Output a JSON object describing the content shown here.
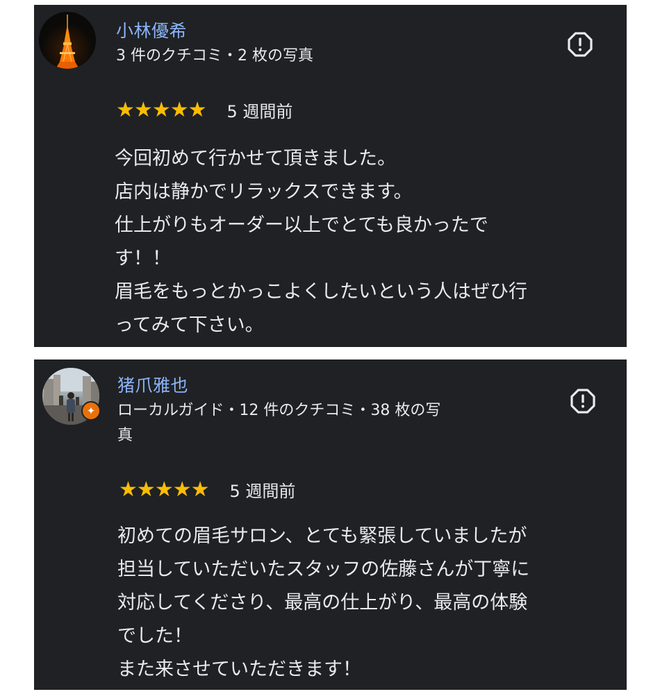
{
  "reviews": [
    {
      "reviewer_name": "小林優希",
      "meta": "3 件のクチコミ・2 枚の写真",
      "avatar": "tokyo-tower-photo",
      "rating": 5,
      "stars": "★★★★★",
      "time": "5 週間前",
      "text": "今回初めて行かせて頂きました。\n店内は静かでリラックスできます。\n仕上がりもオーダー以上でとても良かったで\nす！！\n眉毛をもっとかっこよくしたいという人はぜひ行\nってみて下さい。"
    },
    {
      "reviewer_name": "猪爪雅也",
      "meta": "ローカルガイド・12 件のクチコミ・38 枚の写\n真",
      "avatar": "street-photo",
      "badge": "local-guide-badge",
      "rating": 5,
      "stars": "★★★★★",
      "time": "5 週間前",
      "text": "初めての眉毛サロン、とても緊張していましたが\n担当していただいたスタッフの佐藤さんが丁寧に\n対応してくださり、最高の仕上がり、最高の体験\nでした！\nまた来させていただきます！"
    }
  ],
  "colors": {
    "card_bg": "#202124",
    "name": "#8ab4f8",
    "star": "#fbbc04",
    "text": "#e8eaed"
  },
  "icons": {
    "report": "report-flag-icon",
    "star": "star-icon"
  }
}
